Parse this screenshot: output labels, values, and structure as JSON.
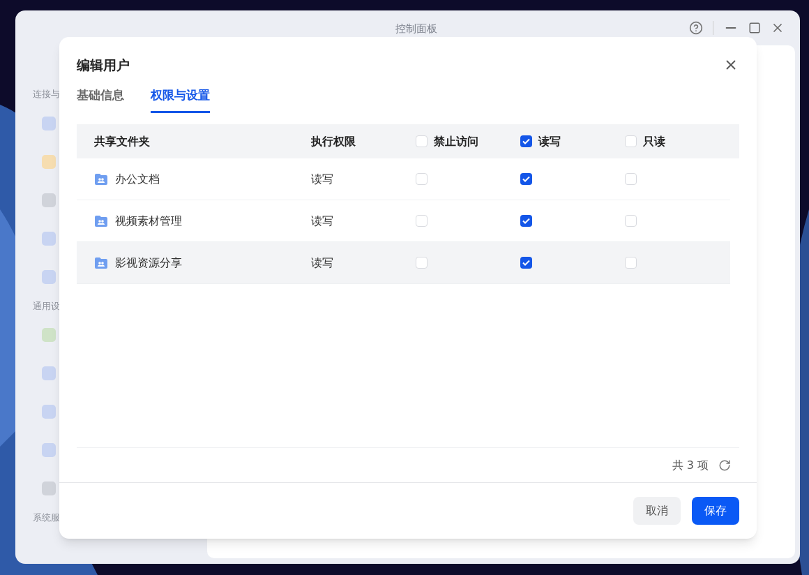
{
  "window": {
    "title": "控制面板"
  },
  "sidebar": {
    "sections": [
      "连接与",
      "通用设",
      "系统服"
    ]
  },
  "dialog": {
    "title": "编辑用户",
    "tabs": [
      {
        "label": "基础信息",
        "selected": false
      },
      {
        "label": "权限与设置",
        "selected": true
      }
    ],
    "table": {
      "columns": [
        {
          "label": "共享文件夹",
          "kind": "text"
        },
        {
          "label": "执行权限",
          "kind": "text"
        },
        {
          "label": "禁止访问",
          "kind": "checkbox",
          "checked": false
        },
        {
          "label": "读写",
          "kind": "checkbox",
          "checked": true
        },
        {
          "label": "只读",
          "kind": "checkbox",
          "checked": false
        }
      ],
      "rows": [
        {
          "name": "办公文档",
          "permission": "读写",
          "checks": [
            false,
            true,
            false
          ],
          "hovered": false
        },
        {
          "name": "视频素材管理",
          "permission": "读写",
          "checks": [
            false,
            true,
            false
          ],
          "hovered": false
        },
        {
          "name": "影视资源分享",
          "permission": "读写",
          "checks": [
            false,
            true,
            false
          ],
          "hovered": true
        }
      ]
    },
    "total": "共 3 项",
    "buttons": [
      {
        "label": "取消",
        "kind": "secondary"
      },
      {
        "label": "保存",
        "kind": "primary"
      }
    ]
  }
}
